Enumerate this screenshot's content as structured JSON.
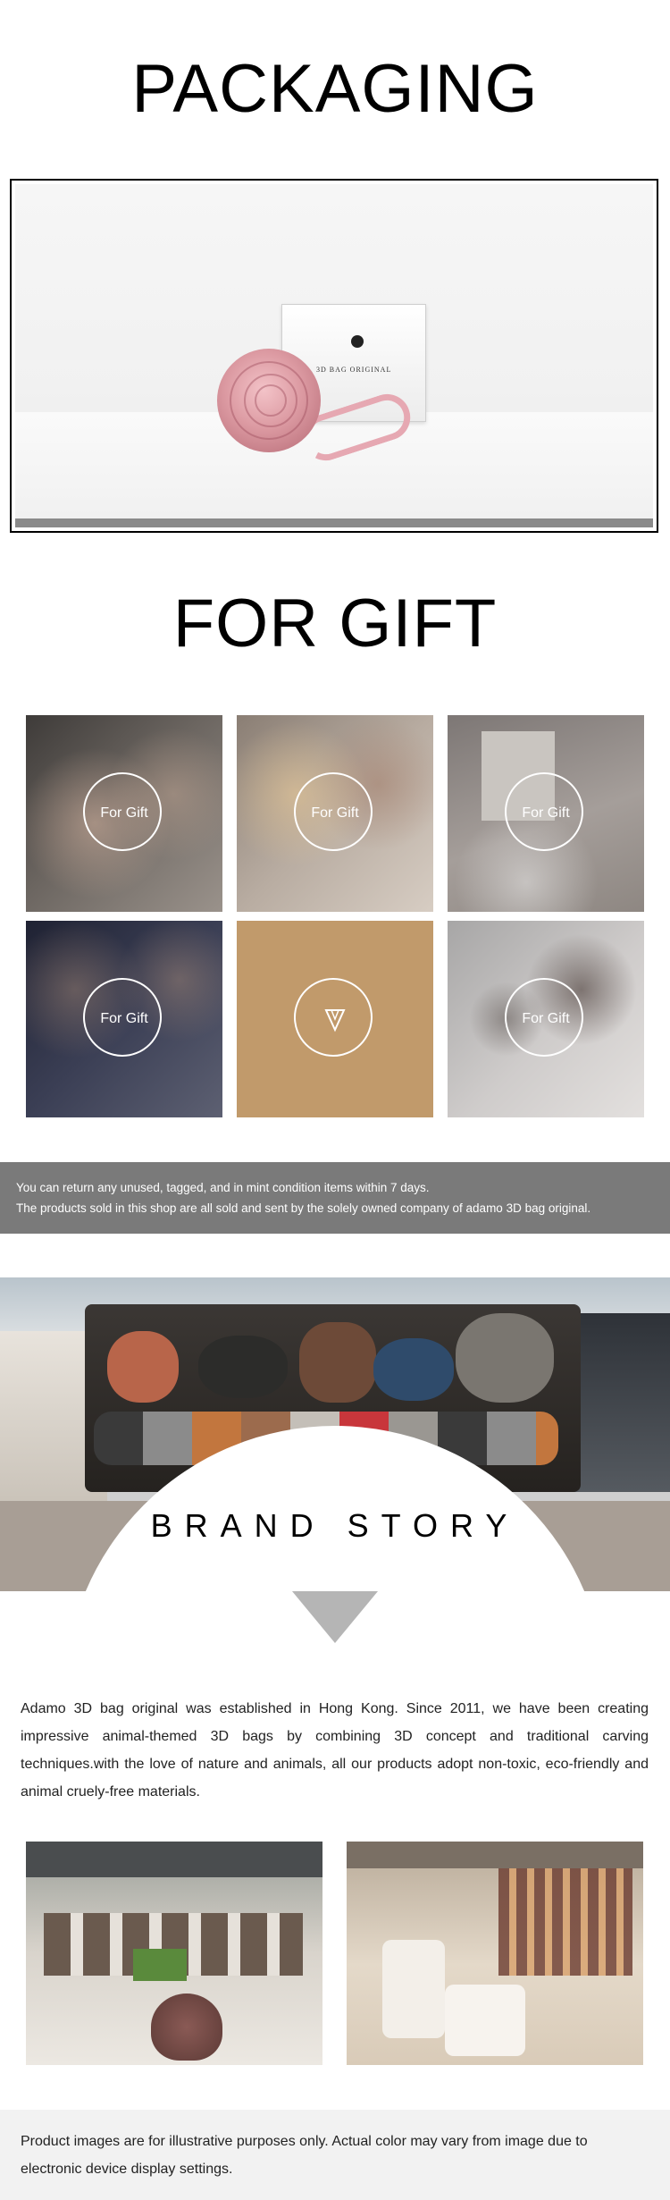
{
  "packaging": {
    "title": "PACKAGING",
    "box_brand_text": "3D BAG ORIGINAL"
  },
  "for_gift": {
    "title": "FOR GIFT",
    "tiles": [
      {
        "label": "For Gift",
        "scene": "family"
      },
      {
        "label": "For Gift",
        "scene": "couple"
      },
      {
        "label": "For Gift",
        "scene": "colleagues"
      },
      {
        "label": "For Gift",
        "scene": "friends"
      },
      {
        "label": "",
        "scene": "arrow",
        "icon": "triangle-down-outline-icon"
      },
      {
        "label": "For Gift",
        "scene": "coworkers"
      }
    ],
    "tile_accent": "#c19a6b"
  },
  "policy": {
    "line1": "You can return any unused, tagged, and in mint condition items within 7 days.",
    "line2": "The products sold in this shop are all sold and sent by the solely owned company of adamo 3D bag original."
  },
  "brand": {
    "title": "BRAND STORY",
    "story": "Adamo 3D bag original was established in Hong Kong. Since 2011, we have been creating impressive animal-themed 3D bags by combining 3D concept and traditional carving techniques.with the love of nature and animals, all our products adopt non-toxic, eco-friendly and animal cruely-free materials.",
    "arrow_color": "#b5b5b5"
  },
  "footer": {
    "disclaimer": "Product images are for illustrative purposes only. Actual color may vary from image due to electronic device display settings."
  }
}
